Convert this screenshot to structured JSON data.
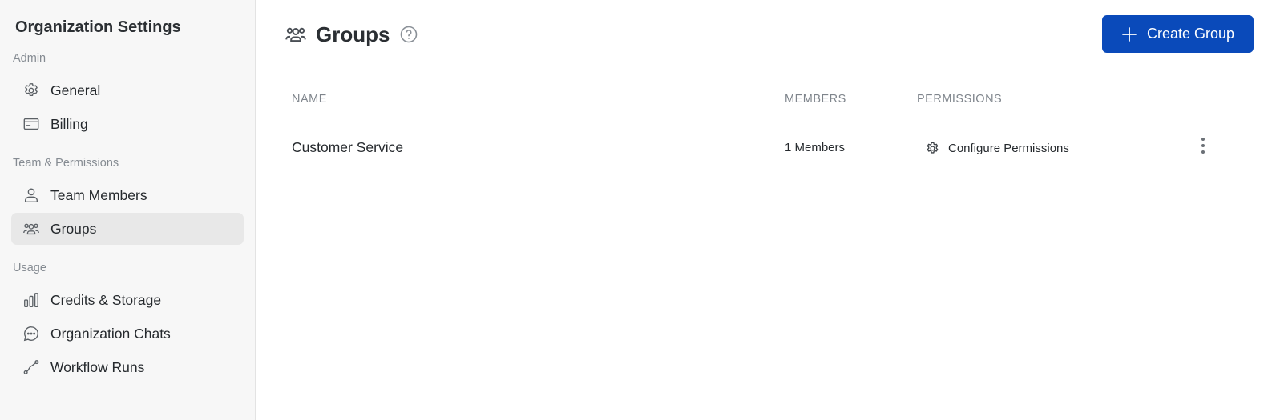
{
  "sidebar": {
    "title": "Organization Settings",
    "sections": [
      {
        "label": "Admin",
        "items": [
          {
            "label": "General",
            "icon": "gear-icon"
          },
          {
            "label": "Billing",
            "icon": "credit-card-icon"
          }
        ]
      },
      {
        "label": "Team & Permissions",
        "items": [
          {
            "label": "Team Members",
            "icon": "user-icon"
          },
          {
            "label": "Groups",
            "icon": "users-group-icon",
            "active": true
          }
        ]
      },
      {
        "label": "Usage",
        "items": [
          {
            "label": "Credits & Storage",
            "icon": "bar-chart-icon"
          },
          {
            "label": "Organization Chats",
            "icon": "chat-bubble-icon"
          },
          {
            "label": "Workflow Runs",
            "icon": "workflow-icon"
          }
        ]
      }
    ]
  },
  "header": {
    "title": "Groups",
    "icon": "users-group-icon",
    "help_icon": "question-circle-icon",
    "create_button_label": "Create Group"
  },
  "table": {
    "columns": {
      "name": "NAME",
      "members": "MEMBERS",
      "permissions": "PERMISSIONS"
    },
    "rows": [
      {
        "name": "Customer Service",
        "members": "1 Members",
        "permissions_action": "Configure Permissions"
      }
    ]
  },
  "colors": {
    "primary_button": "#0a4aba",
    "sidebar_bg": "#f7f7f7",
    "active_item_bg": "#e8e8e8"
  }
}
